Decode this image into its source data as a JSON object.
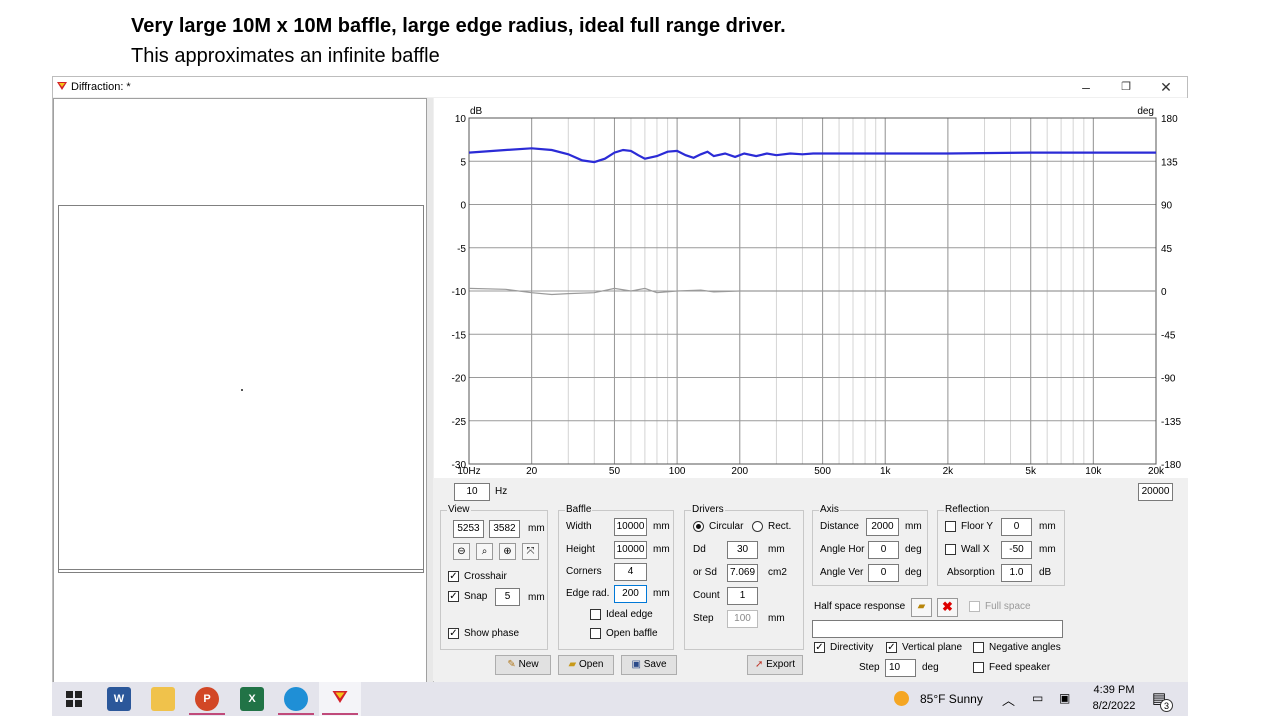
{
  "slide": {
    "title": "Very large 10M x 10M baffle, large edge radius, ideal full range driver.",
    "subtitle": "This approximates an infinite baffle"
  },
  "window": {
    "title": "Diffraction: *",
    "controls": {
      "minimize": "–",
      "restore": "❐",
      "close": "✕"
    }
  },
  "chart_data": {
    "type": "line",
    "xscale": "log",
    "xlim": [
      10,
      20000
    ],
    "ylim": [
      -30,
      10
    ],
    "y2lim": [
      -180,
      180
    ],
    "ylabel": "dB",
    "y2label": "deg",
    "grid": true,
    "xticks": [
      {
        "v": 10,
        "label": "10Hz"
      },
      {
        "v": 20,
        "label": "20"
      },
      {
        "v": 50,
        "label": "50"
      },
      {
        "v": 100,
        "label": "100"
      },
      {
        "v": 200,
        "label": "200"
      },
      {
        "v": 500,
        "label": "500"
      },
      {
        "v": 1000,
        "label": "1k"
      },
      {
        "v": 2000,
        "label": "2k"
      },
      {
        "v": 5000,
        "label": "5k"
      },
      {
        "v": 10000,
        "label": "10k"
      },
      {
        "v": 20000,
        "label": "20k"
      }
    ],
    "yticks": [
      "10",
      "5",
      "0",
      "-5",
      "-10",
      "-15",
      "-20",
      "-25",
      "-30"
    ],
    "y2ticks": [
      "180",
      "135",
      "90",
      "45",
      "0",
      "-45",
      "-90",
      "-135",
      "-180"
    ],
    "series": [
      {
        "color": "#2b2bd6",
        "axis": "left",
        "x": [
          10,
          15,
          20,
          25,
          30,
          35,
          40,
          45,
          50,
          55,
          60,
          65,
          70,
          80,
          90,
          100,
          110,
          120,
          130,
          140,
          150,
          170,
          190,
          210,
          240,
          270,
          300,
          350,
          400,
          450,
          500,
          600,
          800,
          1000,
          2000,
          5000,
          10000,
          20000
        ],
        "y": [
          6.0,
          6.3,
          6.5,
          6.3,
          5.8,
          5.1,
          4.9,
          5.3,
          6.0,
          6.3,
          6.2,
          5.7,
          5.3,
          5.6,
          6.1,
          6.2,
          5.7,
          5.4,
          5.8,
          6.1,
          5.6,
          5.9,
          5.5,
          5.9,
          5.6,
          5.9,
          5.7,
          5.9,
          5.8,
          5.9,
          5.9,
          5.9,
          5.9,
          5.9,
          5.9,
          6.0,
          6.0,
          6.0
        ]
      },
      {
        "color": "#9a9a9a",
        "axis": "right",
        "x": [
          10,
          15,
          20,
          25,
          30,
          40,
          50,
          60,
          70,
          80,
          100,
          130,
          150,
          200,
          300,
          500,
          1000,
          2000,
          5000,
          10000,
          20000
        ],
        "y": [
          2.7,
          1.8,
          -1.8,
          -3.6,
          -2.7,
          -1.8,
          2.7,
          0,
          2.7,
          -1.8,
          0,
          0.9,
          -0.9,
          0,
          0,
          0,
          0,
          0,
          0,
          0,
          0
        ]
      }
    ]
  },
  "freq": {
    "min_value": "10",
    "unit": "Hz",
    "max_value": "20000"
  },
  "view": {
    "title": "View",
    "x_value": "5253",
    "y_value": "3582",
    "unit": "mm",
    "crosshair_label": "Crosshair",
    "crosshair_checked": "✓",
    "snap_label": "Snap",
    "snap_checked": "✓",
    "snap_value": "5",
    "snap_unit": "mm",
    "show_phase_label": "Show phase",
    "show_phase_checked": "✓"
  },
  "baffle": {
    "title": "Baffle",
    "width_label": "Width",
    "width_value": "10000",
    "width_unit": "mm",
    "height_label": "Height",
    "height_value": "10000",
    "height_unit": "mm",
    "corners_label": "Corners",
    "corners_value": "4",
    "edge_label": "Edge rad.",
    "edge_value": "200",
    "edge_unit": "mm",
    "ideal_edge_label": "Ideal edge",
    "open_baffle_label": "Open baffle"
  },
  "drivers": {
    "title": "Drivers",
    "circular_label": "Circular",
    "rect_label": "Rect.",
    "dd_label": "Dd",
    "dd_value": "30",
    "dd_unit": "mm",
    "sd_label": "or Sd",
    "sd_value": "7.069",
    "sd_unit": "cm2",
    "count_label": "Count",
    "count_value": "1",
    "step_label": "Step",
    "step_value": "100",
    "step_unit": "mm"
  },
  "axis": {
    "title": "Axis",
    "distance_label": "Distance",
    "distance_value": "2000",
    "distance_unit": "mm",
    "hor_label": "Angle Hor",
    "hor_value": "0",
    "hor_unit": "deg",
    "ver_label": "Angle Ver",
    "ver_value": "0",
    "ver_unit": "deg"
  },
  "reflection": {
    "title": "Reflection",
    "floor_label": "Floor Y",
    "floor_value": "0",
    "floor_unit": "mm",
    "wall_label": "Wall  X",
    "wall_value": "-50",
    "wall_unit": "mm",
    "absorption_label": "Absorption",
    "absorption_value": "1.0",
    "absorption_unit": "dB"
  },
  "halfspace": {
    "label": "Half space response",
    "full_space_label": "Full space",
    "path_value": ""
  },
  "options": {
    "directivity_label": "Directivity",
    "directivity_checked": "✓",
    "vertical_label": "Vertical plane",
    "vertical_checked": "✓",
    "negative_label": "Negative angles",
    "step_label": "Step",
    "step_value": "10",
    "step_unit": "deg",
    "feed_label": "Feed speaker"
  },
  "buttons": {
    "new": "New",
    "open": "Open",
    "save": "Save",
    "export": "Export"
  },
  "taskbar": {
    "weather": "85°F  Sunny",
    "time": "4:39 PM",
    "date": "8/2/2022",
    "notifications": "3",
    "word_letter": "W",
    "ppt_letter": "P",
    "excel_letter": "X"
  }
}
